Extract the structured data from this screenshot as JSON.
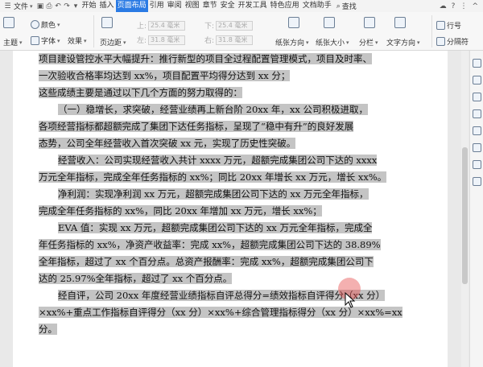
{
  "menubar": {
    "file": "文件",
    "tabs": [
      "开始",
      "插入",
      "页面布局",
      "引用",
      "审阅",
      "视图",
      "章节",
      "安全",
      "开发工具",
      "特色应用",
      "文档助手"
    ],
    "active_tab": "页面布局",
    "search": "查找"
  },
  "ribbon": {
    "theme": "主题",
    "color": "颜色",
    "font": "字体",
    "effect": "效果",
    "margin": "页边距",
    "top_label": "上:",
    "top_val": "25.4 毫米",
    "bottom_label": "下:",
    "bottom_val": "25.4 毫米",
    "left_label": "左:",
    "left_val": "31.8 毫米",
    "right_label": "右:",
    "right_val": "31.8 毫米",
    "orientation": "纸张方向",
    "size": "纸张大小",
    "columns": "分栏",
    "text_dir": "文字方向",
    "line_no": "行号",
    "section_break": "分隔符"
  },
  "doc": {
    "lines": [
      {
        "text": "项目建设管控水平大幅提升：推行新型的项目全过程配置管理模式，项目及时率、",
        "indent": false
      },
      {
        "text": "一次验收合格率均达到 xx%，项目配置平均得分达到 xx 分；",
        "indent": false
      },
      {
        "text": "这些成绩主要是通过以下几个方面的努力取得的：",
        "indent": false
      },
      {
        "text": "（一）稳增长，求突破，经营业绩再上新台阶 20xx 年，xx 公司积极进取，",
        "indent": true
      },
      {
        "text": "各项经营指标都超额完成了集团下达任务指标，呈现了“稳中有升”的良好发展",
        "indent": false
      },
      {
        "text": "态势，公司全年经营收入首次突破 xx 元，实现了历史性突破。",
        "indent": false
      },
      {
        "text": "经营收入：公司实现经营收入共计 xxxx 万元，超额完成集团公司下达的 xxxx",
        "indent": true
      },
      {
        "text": "万元全年指标，完成全年任务指标的 xx%；同比 20xx 年增长 xx 万元，增长 xx%。",
        "indent": false
      },
      {
        "text": "净利润：实现净利润 xx 万元，超额完成集团公司下达的 xx 万元全年指标，",
        "indent": true
      },
      {
        "text": "完成全年任务指标的 xx%，同比 20xx 年增加 xx 万元，增长 xx%；",
        "indent": false
      },
      {
        "text": "EVA 值：实现 xx 万元，超额完成集团公司下达的 xx 万元全年指标，完成全",
        "indent": true
      },
      {
        "text": "年任务指标的 xx%，净资产收益率：完成 xx%，超额完成集团公司下达的 38.89%",
        "indent": false
      },
      {
        "text": "全年指标，超过了 xx 个百分点。总资产报酬率：完成 xx%，超额完成集团公司下",
        "indent": false
      },
      {
        "text": "达的 25.97%全年指标，超过了 xx 个百分点。",
        "indent": false
      },
      {
        "text": "经自评，公司 20xx 年度经营业绩指标自评总得分=绩效指标自评得分（xx 分）",
        "indent": true
      },
      {
        "text": "×xx%+重点工作指标自评得分（xx 分）×xx%+综合管理指标得分（xx 分）×xx%=xx",
        "indent": false
      },
      {
        "text": "分。",
        "indent": false
      }
    ]
  }
}
